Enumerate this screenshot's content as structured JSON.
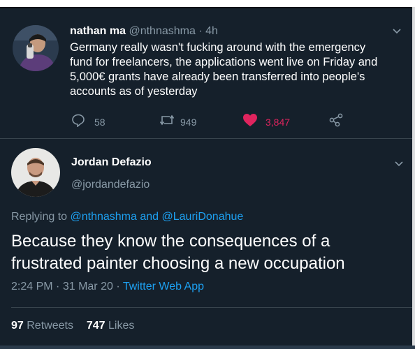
{
  "tweet1": {
    "name": "nathan ma",
    "handle": "@nthnashma",
    "separator": "·",
    "age": "4h",
    "lines": [
      "Germany really wasn't fucking around with the emergency",
      "fund for freelancers, the applications went live on Friday and",
      "5,000€ grants have already been transferred into people's",
      "accounts as of yesterday"
    ],
    "replies": "58",
    "retweets": "949",
    "likes": "3,847",
    "colors": {
      "like": "#e0245e",
      "muted": "#8899a6"
    }
  },
  "tweet2": {
    "name": "Jordan Defazio",
    "handle": "@jordandefazio",
    "replying_prefix": "Replying to",
    "replying_user1": "@nthnashma",
    "replying_and": "and",
    "replying_user2": "@LauriDonahue",
    "lines": [
      "Because they know the consequences of a",
      "frustrated painter choosing a new occupation"
    ],
    "time": "2:24 PM",
    "sep1": "·",
    "date": "31 Mar 20",
    "sep2": "·",
    "source": "Twitter Web App",
    "retweets_count": "97",
    "retweets_label": "Retweets",
    "likes_count": "747",
    "likes_label": "Likes"
  },
  "theme": {
    "background": "#15202b",
    "accent": "#1da1f2",
    "text": "#ffffff",
    "muted": "#8899a6"
  }
}
